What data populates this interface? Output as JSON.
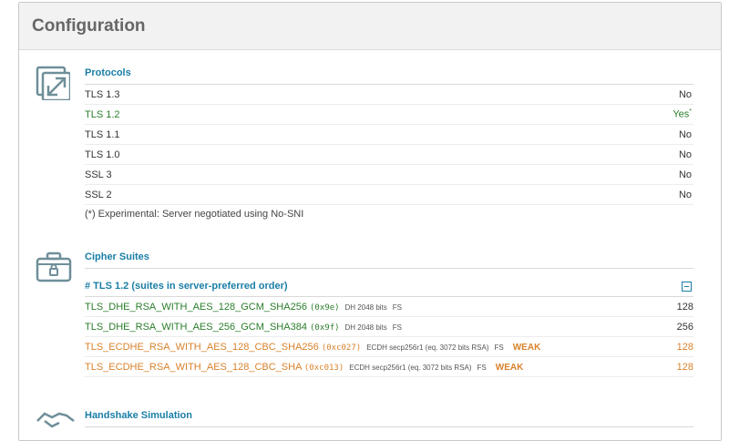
{
  "panel": {
    "title": "Configuration"
  },
  "protocols": {
    "title": "Protocols",
    "rows": [
      {
        "name": "TLS 1.3",
        "value": "No"
      },
      {
        "name": "TLS 1.2",
        "value": "Yes",
        "mark": "*"
      },
      {
        "name": "TLS 1.1",
        "value": "No"
      },
      {
        "name": "TLS 1.0",
        "value": "No"
      },
      {
        "name": "SSL 3",
        "value": "No"
      },
      {
        "name": "SSL 2",
        "value": "No"
      }
    ],
    "note": "(*) Experimental: Server negotiated using No-SNI"
  },
  "cipher_suites": {
    "title": "Cipher Suites",
    "group_label": "# TLS 1.2 (suites in server-preferred order)",
    "suites": [
      {
        "name": "TLS_DHE_RSA_WITH_AES_128_GCM_SHA256",
        "code": "(0x9e)",
        "kex": "DH 2048 bits",
        "fs": "FS",
        "weak": "",
        "bits": "128"
      },
      {
        "name": "TLS_DHE_RSA_WITH_AES_256_GCM_SHA384",
        "code": "(0x9f)",
        "kex": "DH 2048 bits",
        "fs": "FS",
        "weak": "",
        "bits": "256"
      },
      {
        "name": "TLS_ECDHE_RSA_WITH_AES_128_CBC_SHA256",
        "code": "(0xc027)",
        "kex": "ECDH secp256r1 (eq. 3072 bits RSA)",
        "fs": "FS",
        "weak": "WEAK",
        "bits": "128"
      },
      {
        "name": "TLS_ECDHE_RSA_WITH_AES_128_CBC_SHA",
        "code": "(0xc013)",
        "kex": "ECDH secp256r1 (eq. 3072 bits RSA)",
        "fs": "FS",
        "weak": "WEAK",
        "bits": "128"
      }
    ]
  },
  "handshake": {
    "title": "Handshake Simulation"
  },
  "colors": {
    "accent": "#1a7ea6",
    "ok": "#2a7d2a",
    "warn": "#d9822b"
  },
  "icons": [
    "expand-arrows-icon",
    "briefcase-lock-icon",
    "handshake-icon",
    "collapse-icon"
  ]
}
